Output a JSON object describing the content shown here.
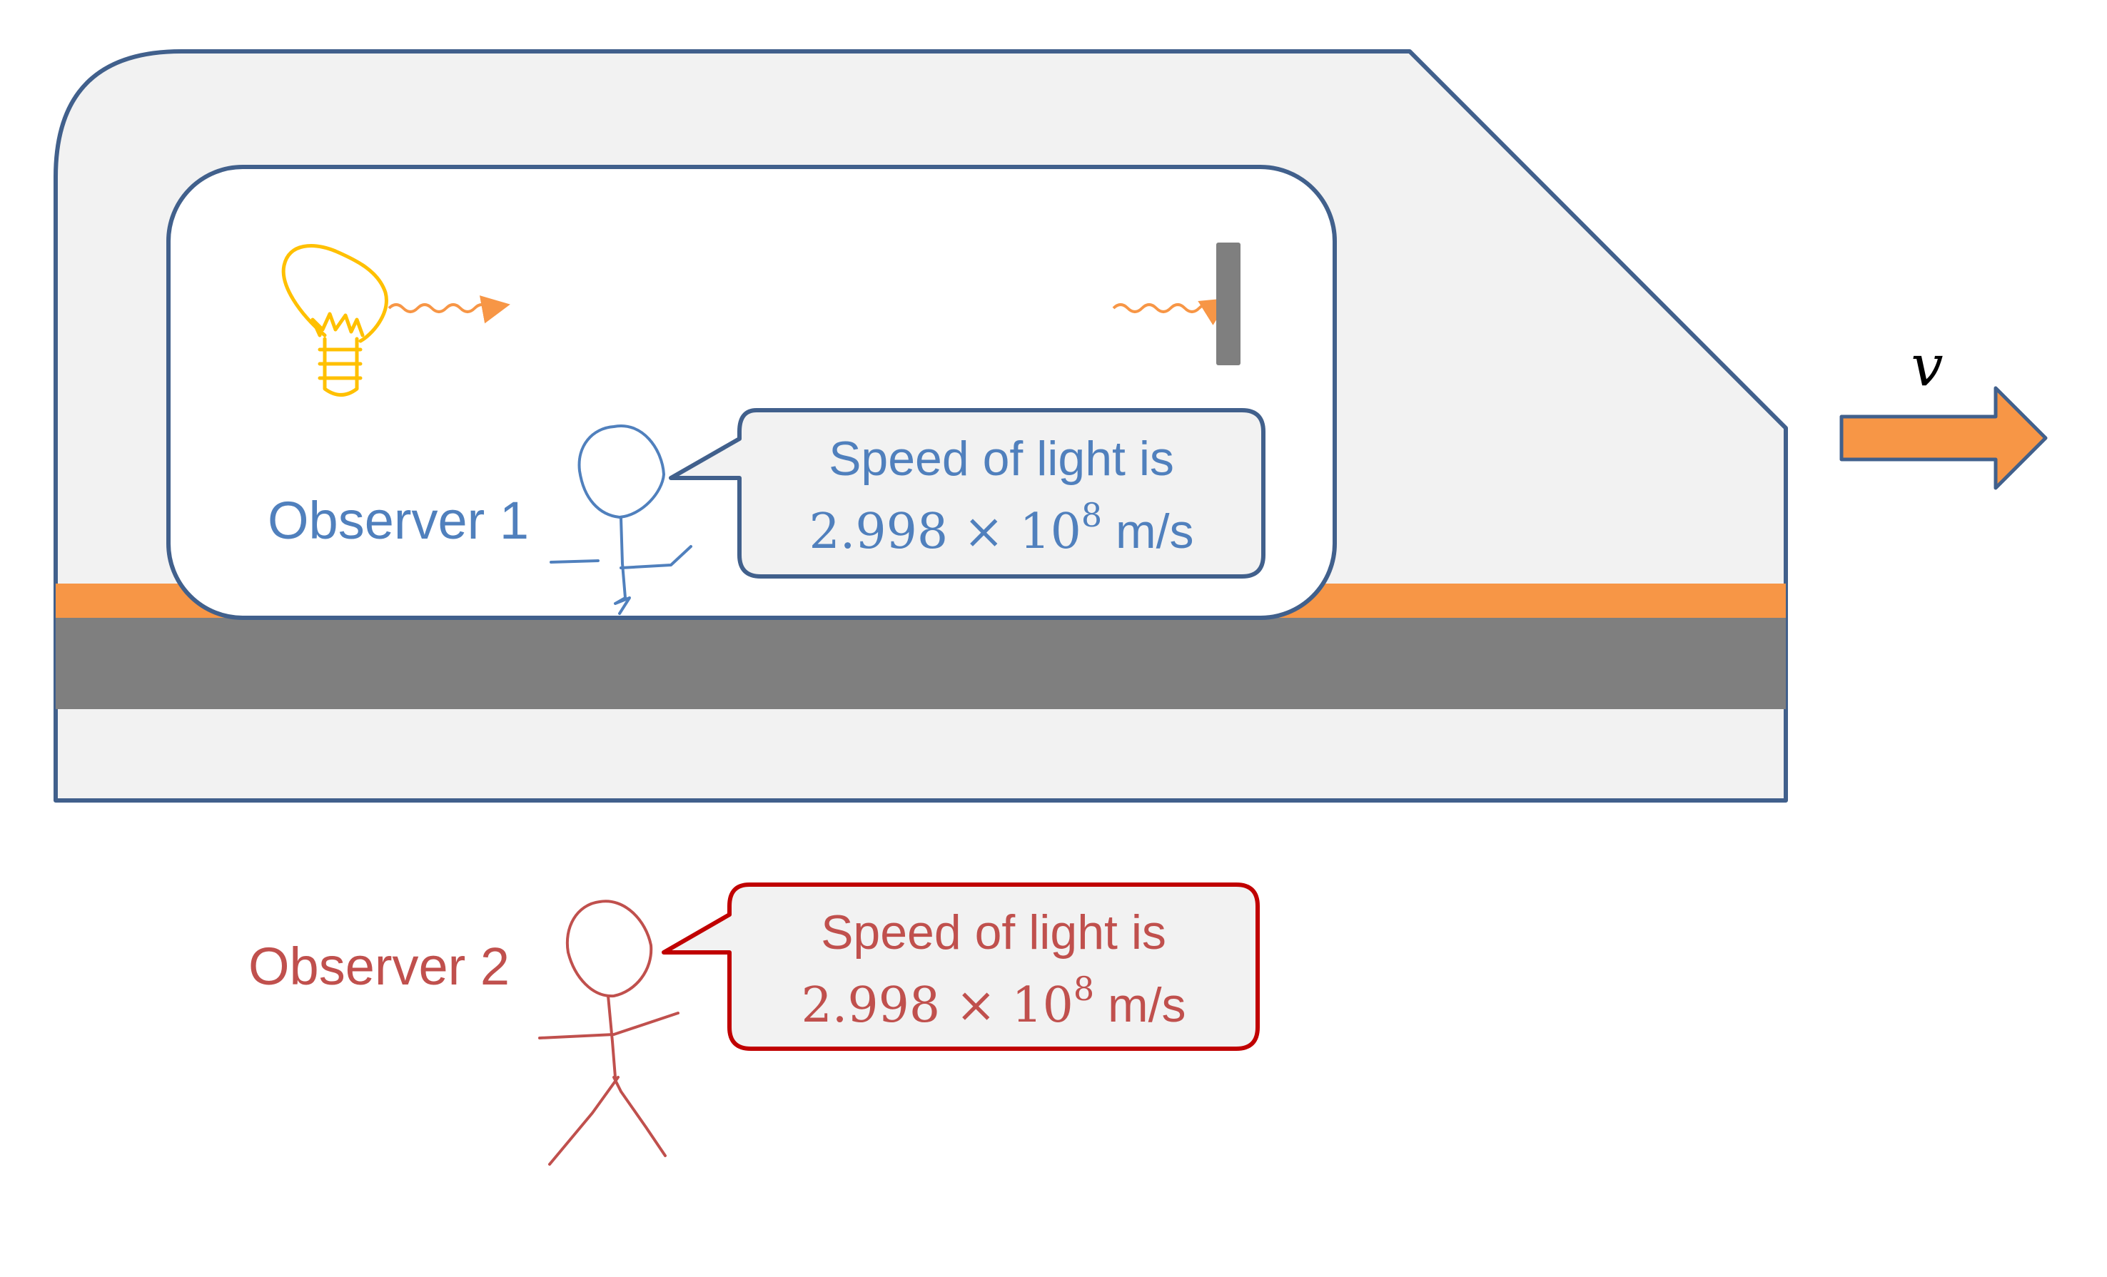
{
  "colors": {
    "train_body_fill": "#f2f2f2",
    "train_outline": "#41608c",
    "stripe_orange": "#f79646",
    "rail_gray": "#7f7f7f",
    "observer1_blue": "#5080bd",
    "observer2_red": "#c0504d",
    "bubble2_border": "#c00000",
    "bulb_yellow": "#ffc000",
    "mirror_gray": "#7f7f7f"
  },
  "velocity": {
    "symbol": "v"
  },
  "observer1": {
    "label": "Observer 1",
    "bubble_line1": "Speed of light is",
    "bubble_value": "2.998 × 10",
    "bubble_exponent": "8",
    "bubble_unit": " m/s"
  },
  "observer2": {
    "label": "Observer 2",
    "bubble_line1": "Speed of light is",
    "bubble_value": "2.998 × 10",
    "bubble_exponent": "8",
    "bubble_unit": " m/s"
  },
  "icons": [
    "light-bulb-icon",
    "light-wave-icon",
    "mirror-icon",
    "velocity-arrow-icon",
    "stick-figure-icon"
  ]
}
